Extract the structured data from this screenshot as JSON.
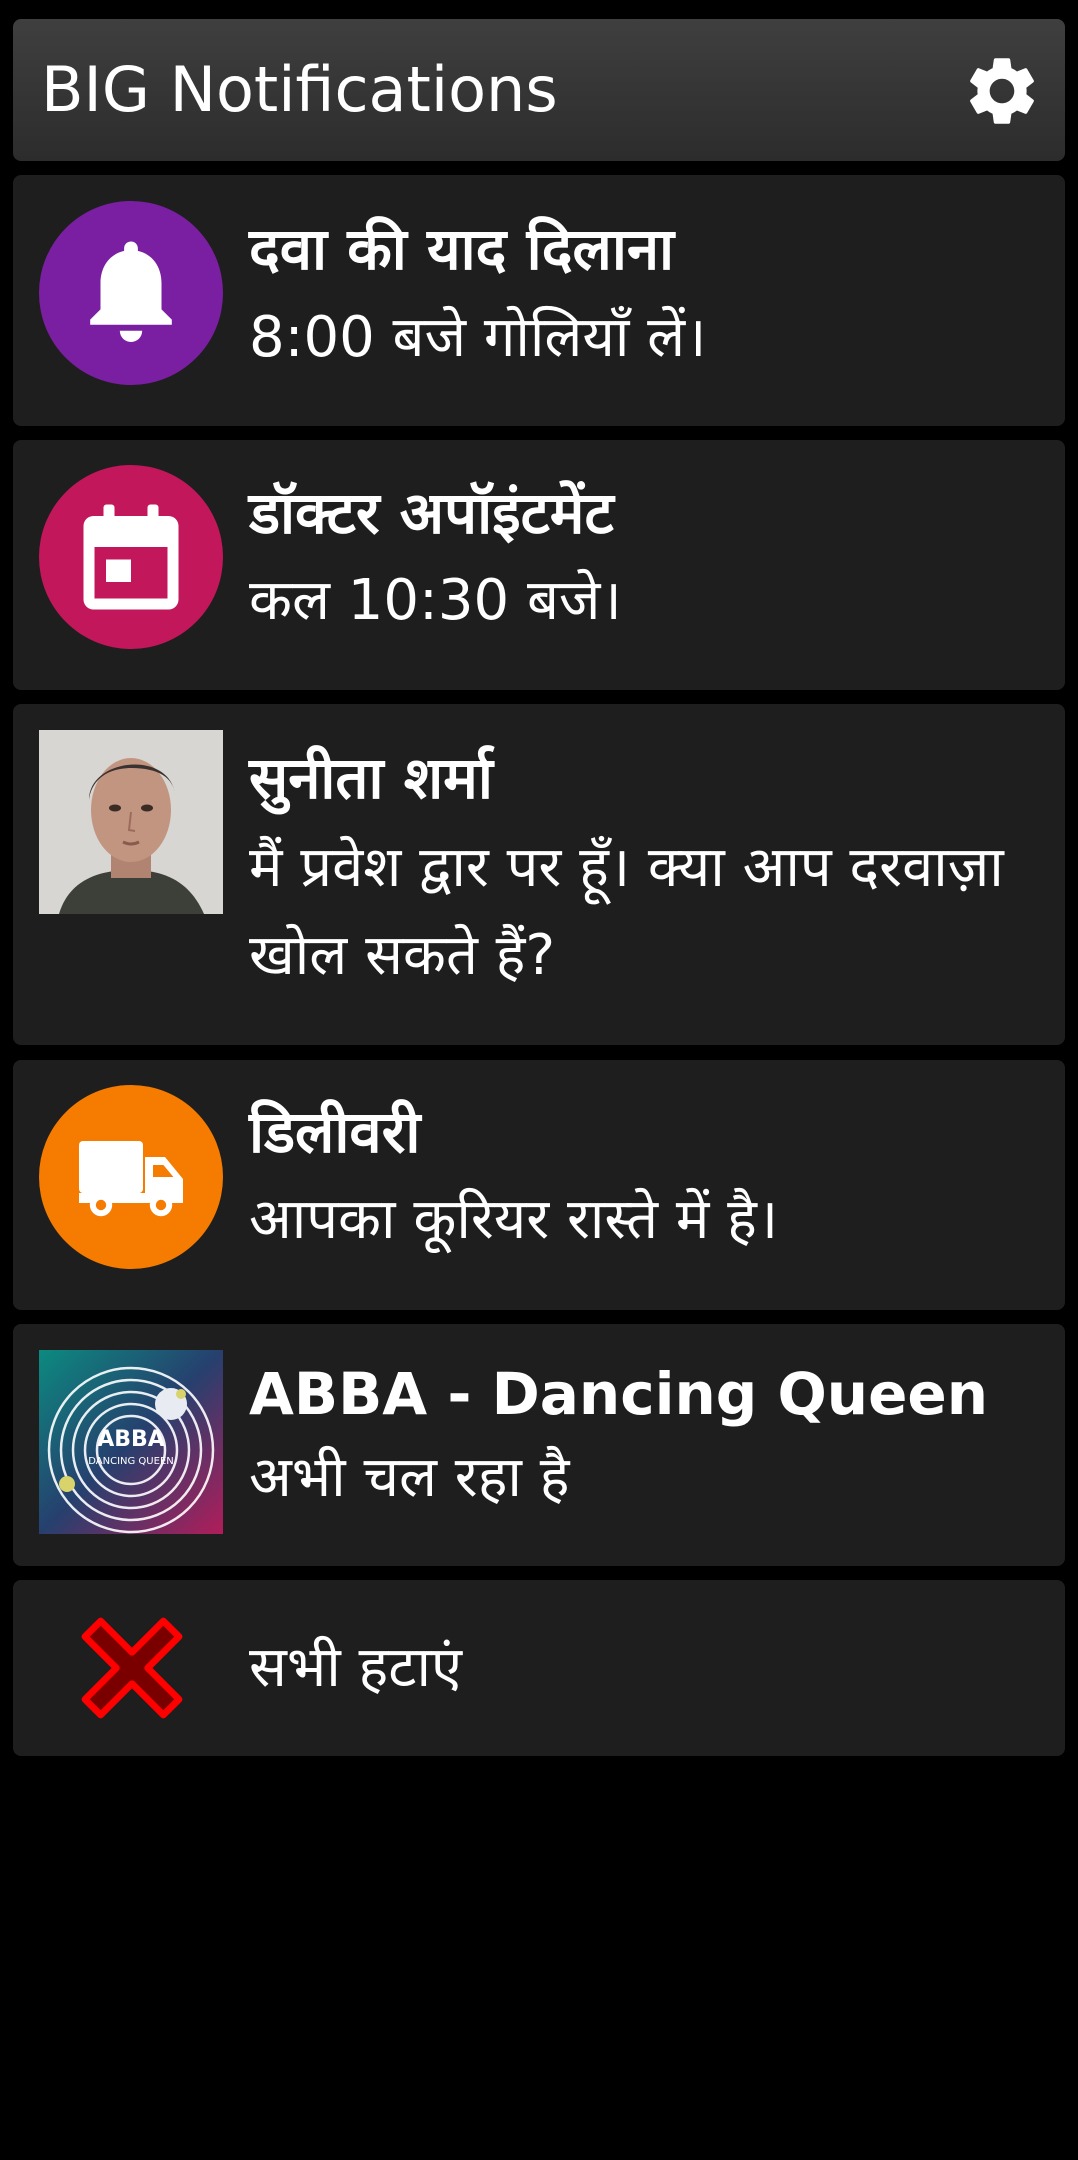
{
  "header": {
    "title": "BIG Notifications",
    "settings_icon": "gear-icon"
  },
  "notifications": [
    {
      "title": "दवा की याद दिलाना",
      "body": "8:00 बजे गोलियाँ लें।",
      "icon": "bell-icon",
      "icon_bg": "#7b1fa2"
    },
    {
      "title": "डॉक्टर अपॉइंटमेंट",
      "body": "कल 10:30 बजे।",
      "icon": "calendar-icon",
      "icon_bg": "#c2185b"
    },
    {
      "title": "सुनीता शर्मा",
      "body": "मैं प्रवेश द्वार पर हूँ। क्या आप दरवाज़ा खोल सकते हैं?",
      "icon": "contact-photo"
    },
    {
      "title": "डिलीवरी",
      "body": "आपका कूरियर रास्ते में है।",
      "icon": "truck-icon",
      "icon_bg": "#f57c00"
    },
    {
      "title": "ABBA - Dancing Queen",
      "body": "अभी चल रहा है",
      "icon": "album-art",
      "album_text": "ABBA",
      "album_subtext": "DANCING QUEEN"
    }
  ],
  "dismiss_all": {
    "label": "सभी हटाएं",
    "icon": "close-icon",
    "icon_color": "#e00000"
  },
  "colors": {
    "background": "#000000",
    "card": "#1e1e1e",
    "header": "#3a3a3a",
    "text": "#ffffff"
  }
}
